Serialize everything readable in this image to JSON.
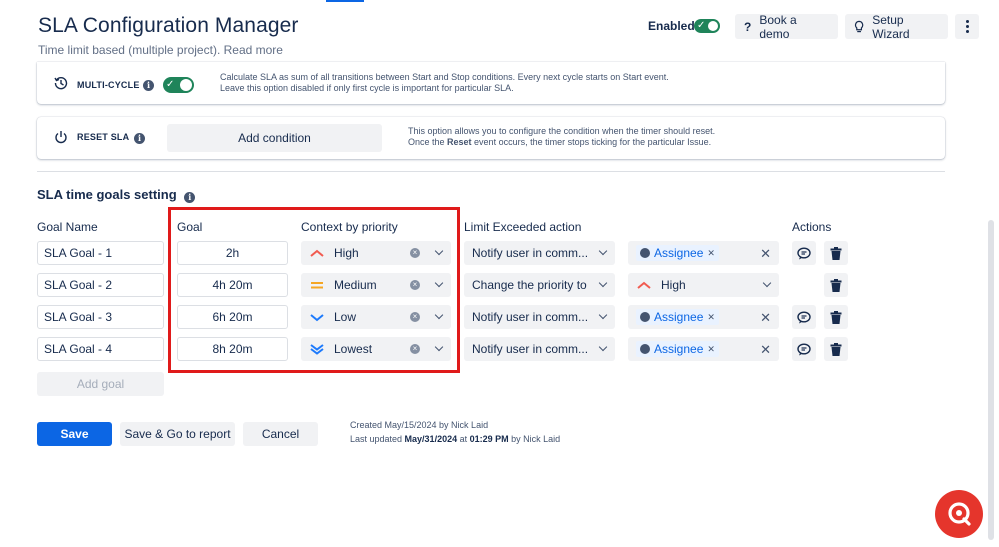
{
  "header": {
    "title": "SLA Configuration Manager",
    "subtitle": "Time limit based (multiple project). Read more",
    "enabled_label": "Enabled",
    "book_demo_label": "Book a demo",
    "setup_wizard_label": "Setup Wizard"
  },
  "multi_cycle": {
    "label": "MULTI-CYCLE",
    "desc_line1": "Calculate SLA as sum of all transitions between Start and Stop conditions. Every next cycle starts on Start event.",
    "desc_line2": "Leave this option disabled if only first cycle is important for particular SLA."
  },
  "reset_sla": {
    "label": "RESET SLA",
    "add_condition_label": "Add condition",
    "desc_line1": "This option allows you to configure the condition when the timer should reset.",
    "desc_line2_pre": "Once the ",
    "desc_line2_bold": "Reset",
    "desc_line2_post": " event occurs, the timer stops ticking for the particular Issue."
  },
  "goals_section": {
    "title": "SLA time goals setting",
    "columns": {
      "goal_name": "Goal Name",
      "goal": "Goal",
      "context": "Context by priority",
      "limit": "Limit Exceeded action",
      "actions": "Actions"
    },
    "rows": [
      {
        "name": "SLA Goal - 1",
        "goal": "2h",
        "priority": "High",
        "action": "Notify user in comm...",
        "target": "Assignee"
      },
      {
        "name": "SLA Goal - 2",
        "goal": "4h 20m",
        "priority": "Medium",
        "action": "Change the priority to",
        "target": "High"
      },
      {
        "name": "SLA Goal - 3",
        "goal": "6h 20m",
        "priority": "Low",
        "action": "Notify user in comm...",
        "target": "Assignee"
      },
      {
        "name": "SLA Goal - 4",
        "goal": "8h 20m",
        "priority": "Lowest",
        "action": "Notify user in comm...",
        "target": "Assignee"
      }
    ],
    "add_goal_label": "Add goal"
  },
  "footer": {
    "save_label": "Save",
    "save_report_label": "Save & Go to report",
    "cancel_label": "Cancel",
    "created_text": "Created May/15/2024 by Nick Laid",
    "updated_pre": "Last updated ",
    "updated_date": "May/31/2024",
    "updated_mid": " at ",
    "updated_time": "01:29 PM",
    "updated_post": " by Nick Laid"
  },
  "colors": {
    "primary": "#0c66e4",
    "toggle_on": "#1f845a",
    "highlight_box": "#e01a1a",
    "priority_high": "#f15b50",
    "priority_medium": "#f5a623",
    "priority_low": "#1d7afc",
    "chat_fab": "#e5352c"
  }
}
